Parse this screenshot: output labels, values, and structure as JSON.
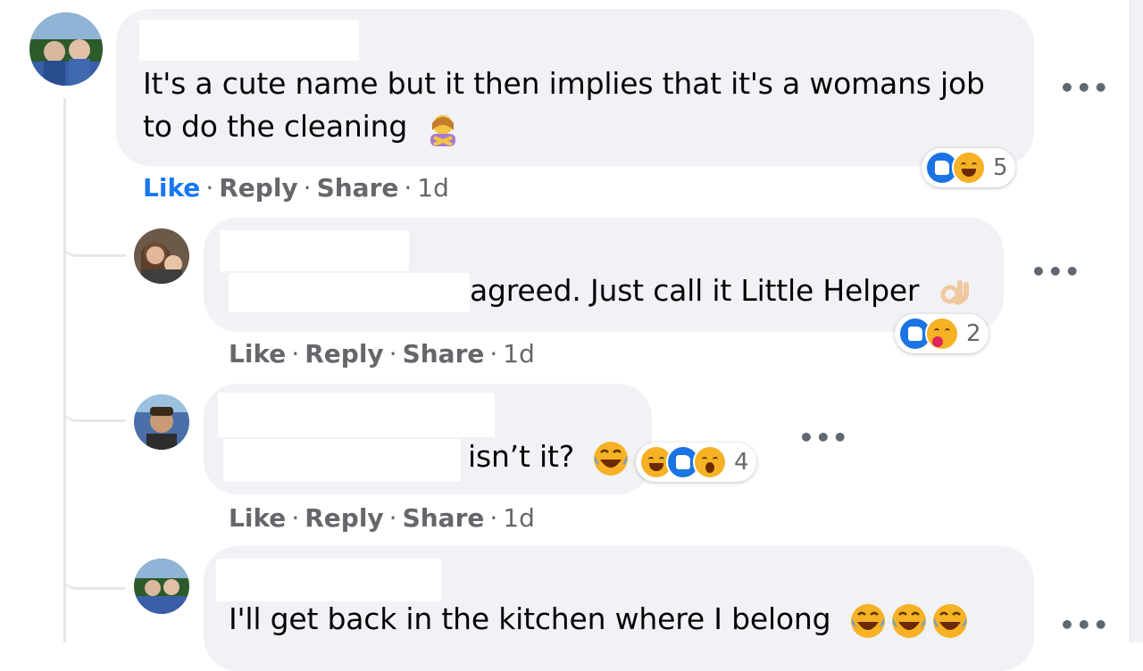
{
  "comments": [
    {
      "text_lines": [
        "It's a cute name but it then implies that it's a womans job",
        "to do the cleaning"
      ],
      "emoji": "woman-gesturing-no-emoji",
      "reaction_count": "5",
      "reaction_icons": [
        "like-reaction-icon",
        "haha-reaction-icon"
      ],
      "actions": {
        "like": "Like",
        "reply": "Reply",
        "share": "Share",
        "sep": "·",
        "time": "1d"
      },
      "more": "•••"
    },
    {
      "text": "agreed. Just call it Little Helper",
      "emoji": "ok-hand-emoji",
      "reaction_count": "2",
      "reaction_icons": [
        "like-reaction-icon",
        "care-reaction-icon"
      ],
      "actions": {
        "like": "Like",
        "reply": "Reply",
        "share": "Share",
        "sep": "·",
        "time": "1d"
      },
      "more": "•••"
    },
    {
      "text": "isn’t it?",
      "emoji": "tears-of-joy-emoji",
      "reaction_count": "4",
      "reaction_icons": [
        "haha-reaction-icon",
        "like-reaction-icon",
        "wow-reaction-icon"
      ],
      "actions": {
        "like": "Like",
        "reply": "Reply",
        "share": "Share",
        "sep": "·",
        "time": "1d"
      },
      "more": "•••"
    },
    {
      "text": "I'll get back in the kitchen where I belong",
      "emoji": "tears-of-joy-emoji",
      "more": "•••"
    }
  ],
  "colors": {
    "bubble": "#f0f2f5",
    "like_blue": "#1877f2",
    "meta_gray": "#65676b"
  }
}
